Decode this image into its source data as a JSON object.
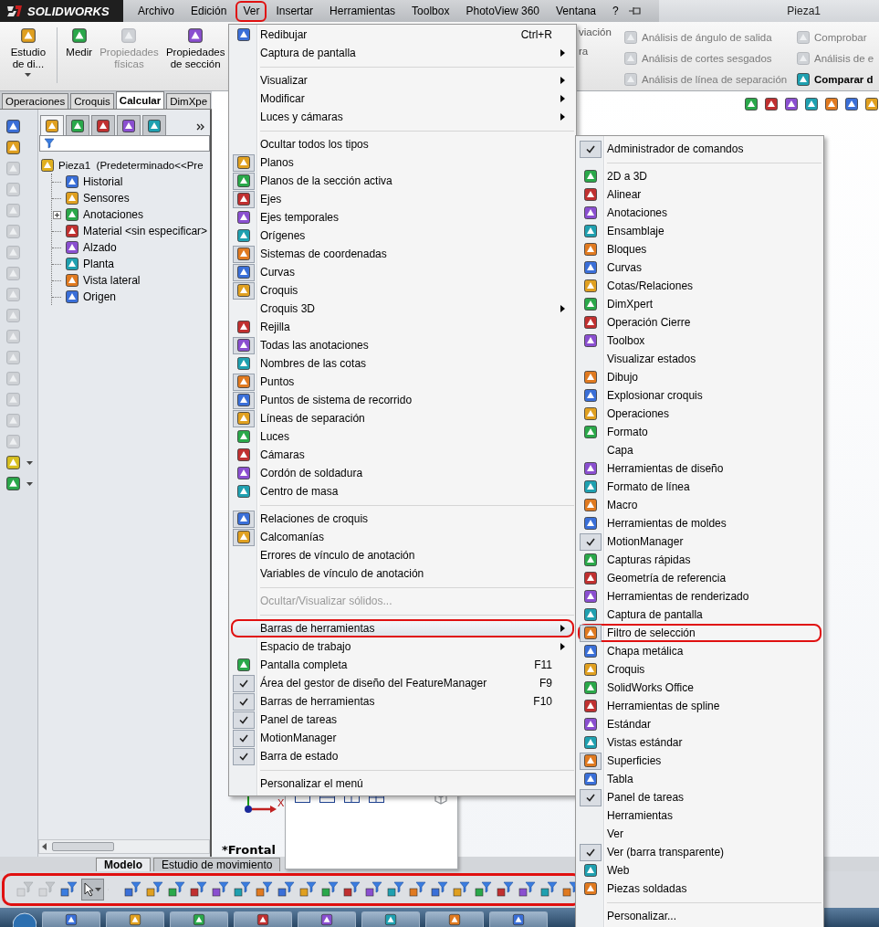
{
  "title_bar": {
    "app_name": "SOLIDWORKS",
    "document_title": "Pieza1",
    "menus": [
      {
        "label": "Archivo",
        "circled": false
      },
      {
        "label": "Edición",
        "circled": false
      },
      {
        "label": "Ver",
        "circled": true
      },
      {
        "label": "Insertar",
        "circled": false
      },
      {
        "label": "Herramientas",
        "circled": false
      },
      {
        "label": "Toolbox",
        "circled": false
      },
      {
        "label": "PhotoView 360",
        "circled": false
      },
      {
        "label": "Ventana",
        "circled": false
      },
      {
        "label": "?",
        "circled": false
      }
    ]
  },
  "ribbon": {
    "buttons": [
      {
        "label": "Estudio de di...",
        "kind": "split",
        "disabled": false
      },
      {
        "label": "Medir",
        "kind": "button",
        "disabled": false
      },
      {
        "label": "Propiedades físicas",
        "kind": "button",
        "disabled": true
      },
      {
        "label": "Propiedades de sección",
        "kind": "button",
        "disabled": false
      }
    ],
    "partial_labels": [
      "viación",
      "ra"
    ],
    "columns": [
      {
        "items": [
          {
            "label": "Análisis de ángulo de salida",
            "disabled": true
          },
          {
            "label": "Análisis de cortes sesgados",
            "disabled": true
          },
          {
            "label": "Análisis de línea de separación",
            "disabled": true
          }
        ]
      },
      {
        "items": [
          {
            "label": "Comprobar",
            "disabled": true
          },
          {
            "label": "Análisis de e",
            "disabled": true
          },
          {
            "label": "Comparar d",
            "disabled": false
          }
        ]
      }
    ]
  },
  "command_tabs": [
    {
      "label": "Operaciones",
      "selected": false
    },
    {
      "label": "Croquis",
      "selected": false
    },
    {
      "label": "Calcular",
      "selected": true
    },
    {
      "label": "DimXpe",
      "selected": false
    }
  ],
  "feature_tree": {
    "panel_tabs": [
      {
        "selected": true
      },
      {
        "selected": false
      },
      {
        "selected": false
      },
      {
        "selected": false
      },
      {
        "selected": false
      }
    ],
    "root": {
      "label": "Pieza1  (Predeterminado<<Pre",
      "children": [
        {
          "label": "Historial",
          "has_children": false
        },
        {
          "label": "Sensores",
          "has_children": false
        },
        {
          "label": "Anotaciones",
          "has_children": true
        },
        {
          "label": "Material <sin especificar>",
          "has_children": false
        },
        {
          "label": "Alzado",
          "has_children": false
        },
        {
          "label": "Planta",
          "has_children": false
        },
        {
          "label": "Vista lateral",
          "has_children": false
        },
        {
          "label": "Origen",
          "has_children": false
        }
      ]
    }
  },
  "graphics": {
    "view_label": "*Frontal",
    "triad_label": "X"
  },
  "model_tabs": [
    {
      "label": "Modelo",
      "selected": true
    },
    {
      "label": "Estudio de movimiento",
      "selected": false
    }
  ],
  "selection_toolbar": {
    "circled": true
  },
  "ver_menu": {
    "items": [
      {
        "kind": "icon",
        "label": "Redibujar",
        "shortcut": "Ctrl+R",
        "checked": false,
        "submenu": false,
        "disabled": false,
        "highlighted": false,
        "circled": false
      },
      {
        "kind": "plain",
        "label": "Captura de pantalla",
        "submenu": true,
        "disabled": false,
        "highlighted": false,
        "circled": false
      },
      {
        "kind": "separator"
      },
      {
        "kind": "plain",
        "label": "Visualizar",
        "submenu": true,
        "disabled": false,
        "highlighted": false,
        "circled": false
      },
      {
        "kind": "plain",
        "label": "Modificar",
        "submenu": true,
        "disabled": false,
        "highlighted": false,
        "circled": false
      },
      {
        "kind": "plain",
        "label": "Luces y cámaras",
        "submenu": true,
        "disabled": false,
        "highlighted": false,
        "circled": false
      },
      {
        "kind": "separator"
      },
      {
        "kind": "plain",
        "label": "Ocultar todos los tipos",
        "submenu": false,
        "disabled": false,
        "highlighted": false,
        "circled": false
      },
      {
        "kind": "icon",
        "label": "Planos",
        "checked": true,
        "submenu": false,
        "disabled": false,
        "highlighted": false,
        "circled": false
      },
      {
        "kind": "icon",
        "label": "Planos de la sección activa",
        "checked": true,
        "submenu": false,
        "disabled": false,
        "highlighted": false,
        "circled": false
      },
      {
        "kind": "icon",
        "label": "Ejes",
        "checked": true,
        "submenu": false,
        "disabled": false,
        "highlighted": false,
        "circled": false
      },
      {
        "kind": "icon",
        "label": "Ejes temporales",
        "checked": false,
        "submenu": false,
        "disabled": false,
        "highlighted": false,
        "circled": false
      },
      {
        "kind": "icon",
        "label": "Orígenes",
        "checked": false,
        "submenu": false,
        "disabled": false,
        "highlighted": false,
        "circled": false
      },
      {
        "kind": "icon",
        "label": "Sistemas de coordenadas",
        "checked": true,
        "submenu": false,
        "disabled": false,
        "highlighted": false,
        "circled": false
      },
      {
        "kind": "icon",
        "label": "Curvas",
        "checked": true,
        "submenu": false,
        "disabled": false,
        "highlighted": false,
        "circled": false
      },
      {
        "kind": "icon",
        "label": "Croquis",
        "checked": true,
        "submenu": false,
        "disabled": false,
        "highlighted": false,
        "circled": false
      },
      {
        "kind": "plain",
        "label": "Croquis 3D",
        "submenu": true,
        "disabled": false,
        "highlighted": false,
        "circled": false
      },
      {
        "kind": "icon",
        "label": "Rejilla",
        "checked": false,
        "submenu": false,
        "disabled": false,
        "highlighted": false,
        "circled": false
      },
      {
        "kind": "icon",
        "label": "Todas las anotaciones",
        "checked": true,
        "submenu": false,
        "disabled": false,
        "highlighted": false,
        "circled": false
      },
      {
        "kind": "icon",
        "label": "Nombres de las cotas",
        "checked": false,
        "submenu": false,
        "disabled": false,
        "highlighted": false,
        "circled": false
      },
      {
        "kind": "icon",
        "label": "Puntos",
        "checked": true,
        "submenu": false,
        "disabled": false,
        "highlighted": false,
        "circled": false
      },
      {
        "kind": "icon",
        "label": "Puntos de sistema de recorrido",
        "checked": true,
        "submenu": false,
        "disabled": false,
        "highlighted": false,
        "circled": false
      },
      {
        "kind": "icon",
        "label": "Líneas de separación",
        "checked": true,
        "submenu": false,
        "disabled": false,
        "highlighted": false,
        "circled": false
      },
      {
        "kind": "icon",
        "label": "Luces",
        "checked": false,
        "submenu": false,
        "disabled": false,
        "highlighted": false,
        "circled": false
      },
      {
        "kind": "icon",
        "label": "Cámaras",
        "checked": false,
        "submenu": false,
        "disabled": false,
        "highlighted": false,
        "circled": false
      },
      {
        "kind": "icon",
        "label": "Cordón de soldadura",
        "checked": false,
        "submenu": false,
        "disabled": false,
        "highlighted": false,
        "circled": false
      },
      {
        "kind": "icon",
        "label": "Centro de masa",
        "checked": false,
        "submenu": false,
        "disabled": false,
        "highlighted": false,
        "circled": false
      },
      {
        "kind": "separator"
      },
      {
        "kind": "icon",
        "label": "Relaciones de croquis",
        "checked": true,
        "submenu": false,
        "disabled": false,
        "highlighted": false,
        "circled": false
      },
      {
        "kind": "icon",
        "label": "Calcomanías",
        "checked": true,
        "submenu": false,
        "disabled": false,
        "highlighted": false,
        "circled": false
      },
      {
        "kind": "plain",
        "label": "Errores de vínculo de anotación",
        "submenu": false,
        "disabled": false,
        "highlighted": false,
        "circled": false
      },
      {
        "kind": "plain",
        "label": "Variables de vínculo de anotación",
        "submenu": false,
        "disabled": false,
        "highlighted": false,
        "circled": false
      },
      {
        "kind": "separator"
      },
      {
        "kind": "plain",
        "label": "Ocultar/Visualizar sólidos...",
        "submenu": false,
        "disabled": true,
        "highlighted": false,
        "circled": false
      },
      {
        "kind": "separator"
      },
      {
        "kind": "plain",
        "label": "Barras de herramientas",
        "submenu": true,
        "disabled": false,
        "highlighted": true,
        "circled": true
      },
      {
        "kind": "plain",
        "label": "Espacio de trabajo",
        "submenu": true,
        "disabled": false,
        "highlighted": false,
        "circled": false
      },
      {
        "kind": "icon",
        "label": "Pantalla completa",
        "shortcut": "F11",
        "checked": false,
        "submenu": false,
        "disabled": false,
        "highlighted": false,
        "circled": false
      },
      {
        "kind": "check",
        "label": "Área del gestor de diseño del FeatureManager",
        "shortcut": "F9",
        "checked": true,
        "submenu": false,
        "disabled": false,
        "highlighted": false,
        "circled": false
      },
      {
        "kind": "check",
        "label": "Barras de herramientas",
        "shortcut": "F10",
        "checked": true,
        "submenu": false,
        "disabled": false,
        "highlighted": false,
        "circled": false
      },
      {
        "kind": "check",
        "label": "Panel de tareas",
        "checked": true,
        "submenu": false,
        "disabled": false,
        "highlighted": false,
        "circled": false
      },
      {
        "kind": "check",
        "label": "MotionManager",
        "checked": true,
        "submenu": false,
        "disabled": false,
        "highlighted": false,
        "circled": false
      },
      {
        "kind": "check",
        "label": "Barra de estado",
        "checked": true,
        "submenu": false,
        "disabled": false,
        "highlighted": false,
        "circled": false
      },
      {
        "kind": "separator"
      },
      {
        "kind": "plain",
        "label": "Personalizar el menú",
        "submenu": false,
        "disabled": false,
        "highlighted": false,
        "circled": false
      }
    ]
  },
  "toolbars_menu": {
    "items": [
      {
        "kind": "check",
        "label": "Administrador de comandos",
        "checked": true,
        "circled": false
      },
      {
        "kind": "separator"
      },
      {
        "kind": "icon",
        "label": "2D a 3D",
        "checked": false,
        "circled": false
      },
      {
        "kind": "icon",
        "label": "Alinear",
        "checked": false,
        "circled": false
      },
      {
        "kind": "icon",
        "label": "Anotaciones",
        "checked": false,
        "circled": false
      },
      {
        "kind": "icon",
        "label": "Ensamblaje",
        "checked": false,
        "circled": false
      },
      {
        "kind": "icon",
        "label": "Bloques",
        "checked": false,
        "circled": false
      },
      {
        "kind": "icon",
        "label": "Curvas",
        "checked": false,
        "circled": false
      },
      {
        "kind": "icon",
        "label": "Cotas/Relaciones",
        "checked": false,
        "circled": false
      },
      {
        "kind": "icon",
        "label": "DimXpert",
        "checked": false,
        "circled": false
      },
      {
        "kind": "icon",
        "label": "Operación Cierre",
        "checked": false,
        "circled": false
      },
      {
        "kind": "icon",
        "label": "Toolbox",
        "checked": false,
        "circled": false
      },
      {
        "kind": "plain",
        "label": "Visualizar estados",
        "circled": false
      },
      {
        "kind": "icon",
        "label": "Dibujo",
        "checked": false,
        "circled": false
      },
      {
        "kind": "icon",
        "label": "Explosionar croquis",
        "checked": false,
        "circled": false
      },
      {
        "kind": "icon",
        "label": "Operaciones",
        "checked": false,
        "circled": false
      },
      {
        "kind": "icon",
        "label": "Formato",
        "checked": false,
        "circled": false
      },
      {
        "kind": "plain",
        "label": "Capa",
        "circled": false
      },
      {
        "kind": "icon",
        "label": "Herramientas de diseño",
        "checked": false,
        "circled": false
      },
      {
        "kind": "icon",
        "label": "Formato de línea",
        "checked": false,
        "circled": false
      },
      {
        "kind": "icon",
        "label": "Macro",
        "checked": false,
        "circled": false
      },
      {
        "kind": "icon",
        "label": "Herramientas de moldes",
        "checked": false,
        "circled": false
      },
      {
        "kind": "check",
        "label": "MotionManager",
        "checked": true,
        "circled": false
      },
      {
        "kind": "icon",
        "label": "Capturas rápidas",
        "checked": false,
        "circled": false
      },
      {
        "kind": "icon",
        "label": "Geometría de referencia",
        "checked": false,
        "circled": false
      },
      {
        "kind": "icon",
        "label": "Herramientas de renderizado",
        "checked": false,
        "circled": false
      },
      {
        "kind": "icon",
        "label": "Captura de pantalla",
        "checked": false,
        "circled": false
      },
      {
        "kind": "icon",
        "label": "Filtro de selección",
        "checked": true,
        "circled": true
      },
      {
        "kind": "icon",
        "label": "Chapa metálica",
        "checked": false,
        "circled": false
      },
      {
        "kind": "icon",
        "label": "Croquis",
        "checked": false,
        "circled": false
      },
      {
        "kind": "icon",
        "label": "SolidWorks Office",
        "checked": false,
        "circled": false
      },
      {
        "kind": "icon",
        "label": "Herramientas de spline",
        "checked": false,
        "circled": false
      },
      {
        "kind": "icon",
        "label": "Estándar",
        "checked": false,
        "circled": false
      },
      {
        "kind": "icon",
        "label": "Vistas estándar",
        "checked": false,
        "circled": false
      },
      {
        "kind": "icon",
        "label": "Superficies",
        "checked": true,
        "circled": false
      },
      {
        "kind": "icon",
        "label": "Tabla",
        "checked": false,
        "circled": false
      },
      {
        "kind": "check",
        "label": "Panel de tareas",
        "checked": true,
        "circled": false
      },
      {
        "kind": "plain",
        "label": "Herramientas",
        "circled": false
      },
      {
        "kind": "plain",
        "label": "Ver",
        "circled": false
      },
      {
        "kind": "check",
        "label": "Ver (barra transparente)",
        "checked": true,
        "circled": false
      },
      {
        "kind": "icon",
        "label": "Web",
        "checked": false,
        "circled": false
      },
      {
        "kind": "icon",
        "label": "Piezas soldadas",
        "checked": false,
        "circled": false
      },
      {
        "kind": "separator"
      },
      {
        "kind": "plain",
        "label": "Personalizar...",
        "circled": false
      }
    ]
  }
}
